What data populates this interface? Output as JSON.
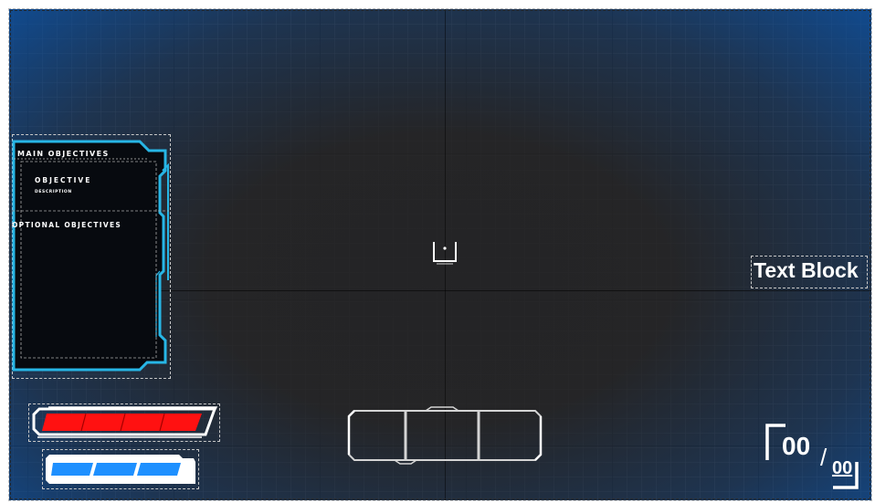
{
  "objectives": {
    "main_title": "MAIN OBJECTIVES",
    "objective_name": "OBJECTIVE",
    "objective_description": "DESCRIPTION",
    "optional_title": "OPTIONAL OBJECTIVES"
  },
  "text_block": {
    "label": "Text Block"
  },
  "ammo": {
    "current": "00",
    "separator": "/",
    "max": "00"
  },
  "health_bar": {
    "fill_fraction": 1.0,
    "segments": 4,
    "color": "#ff1111"
  },
  "shield_bar": {
    "fill_fraction": 1.0,
    "segments": 3,
    "color": "#1e90ff"
  },
  "hotbar": {
    "slots": 3
  },
  "colors": {
    "panel_accent": "#27b6e6",
    "background": "#2a2a2b",
    "vignette": "#0c50a0"
  }
}
